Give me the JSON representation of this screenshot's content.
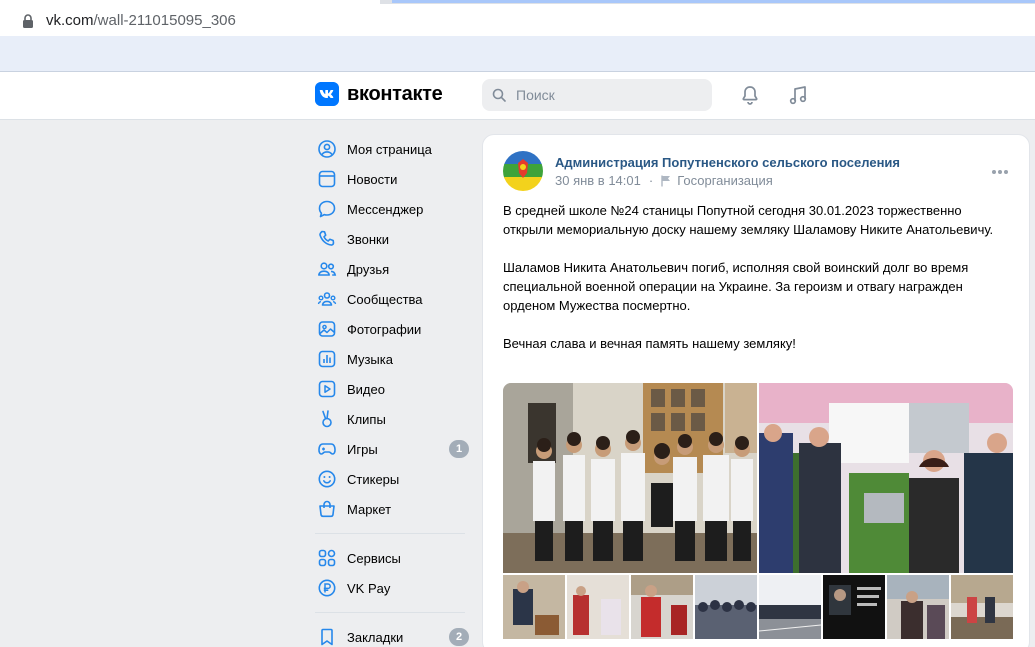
{
  "browser": {
    "url_host": "vk.com",
    "url_path": "/wall-211015095_306"
  },
  "header": {
    "brand": "вконтакте",
    "search_placeholder": "Поиск",
    "accent": "#0077ff"
  },
  "menu": {
    "items": [
      {
        "label": "Моя страница",
        "icon": "user-circle-icon"
      },
      {
        "label": "Новости",
        "icon": "news-icon"
      },
      {
        "label": "Мессенджер",
        "icon": "message-icon"
      },
      {
        "label": "Звонки",
        "icon": "phone-icon"
      },
      {
        "label": "Друзья",
        "icon": "friends-icon"
      },
      {
        "label": "Сообщества",
        "icon": "communities-icon"
      },
      {
        "label": "Фотографии",
        "icon": "photo-icon"
      },
      {
        "label": "Музыка",
        "icon": "music-icon"
      },
      {
        "label": "Видео",
        "icon": "video-icon"
      },
      {
        "label": "Клипы",
        "icon": "clips-icon"
      },
      {
        "label": "Игры",
        "icon": "games-icon",
        "badge": "1"
      },
      {
        "label": "Стикеры",
        "icon": "smile-icon"
      },
      {
        "label": "Маркет",
        "icon": "market-icon"
      }
    ],
    "items2": [
      {
        "label": "Сервисы",
        "icon": "services-icon"
      },
      {
        "label": "VK Pay",
        "icon": "vkpay-icon"
      }
    ],
    "items3": [
      {
        "label": "Закладки",
        "icon": "bookmark-icon",
        "badge": "2"
      }
    ]
  },
  "post": {
    "author": "Администрация Попутненского сельского поселения",
    "date": "30 янв в 14:01",
    "dot": "·",
    "org_type": "Госорганизация",
    "paragraphs": [
      "В средней школе №24 станицы Попутной сегодня 30.01.2023 торжественно открыли мемориальную доску нашему земляку Шаламову Никите Анатольевичу.",
      "Шаламов Никита Анатольевич погиб, исполняя свой воинский долг во время специальной военной операции на Украине. За героизм и отвагу награжден орденом Мужества посмертно.",
      "Вечная слава и вечная память нашему земляку!"
    ],
    "author_color": "#2a5885"
  }
}
